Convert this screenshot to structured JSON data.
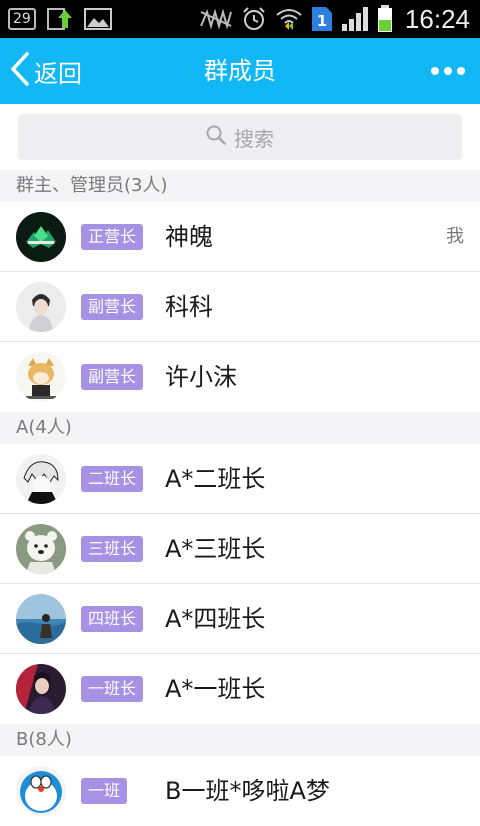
{
  "status_bar": {
    "badge_number": "29",
    "sim_number": "1",
    "time": "16:24"
  },
  "header": {
    "back_label": "返回",
    "title": "群成员"
  },
  "search": {
    "placeholder": "搜索"
  },
  "sections": [
    {
      "title": "群主、管理员(3人)",
      "members": [
        {
          "badge": "正营长",
          "name": "神魄",
          "tag": "我"
        },
        {
          "badge": "副营长",
          "name": "科科"
        },
        {
          "badge": "副营长",
          "name": "许小沫"
        }
      ]
    },
    {
      "title": "A(4人)",
      "members": [
        {
          "badge": "二班长",
          "name": "A*二班长"
        },
        {
          "badge": "三班长",
          "name": "A*三班长"
        },
        {
          "badge": "四班长",
          "name": "A*四班长"
        },
        {
          "badge": "一班长",
          "name": "A*一班长"
        }
      ]
    },
    {
      "title": "B(8人)",
      "members": [
        {
          "badge": "一班",
          "name": "B一班*哆啦A梦"
        }
      ]
    }
  ],
  "colors": {
    "header": "#12b7f5",
    "badge": "#a692e5",
    "status_bar": "#000000"
  }
}
